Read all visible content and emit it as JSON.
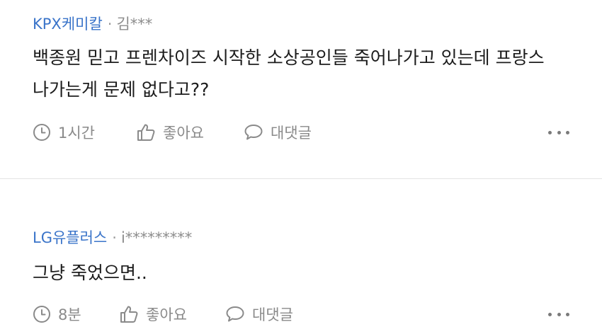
{
  "comments": [
    {
      "author": "KPX케미칼",
      "separator": "·",
      "user_id": "김***",
      "text": "백종원 믿고 프렌차이즈 시작한 소상공인들 죽어나가고 있는데 프랑스 나가는게 문제 없다고??",
      "time": "1시간",
      "like_label": "좋아요",
      "reply_label": "대댓글"
    },
    {
      "author": "LG유플러스",
      "separator": "·",
      "user_id": "i*********",
      "text": "그냥 죽었으면..",
      "time": "8분",
      "like_label": "좋아요",
      "reply_label": "대댓글"
    }
  ],
  "icons": {
    "time": "clock-icon",
    "like": "thumbs-up-icon",
    "reply": "speech-bubble-icon",
    "more": "more-dots-icon"
  },
  "colors": {
    "author": "#3a74c9",
    "meta": "#8a8a8a",
    "text": "#1c1c1c",
    "divider": "#e3e3e3"
  }
}
